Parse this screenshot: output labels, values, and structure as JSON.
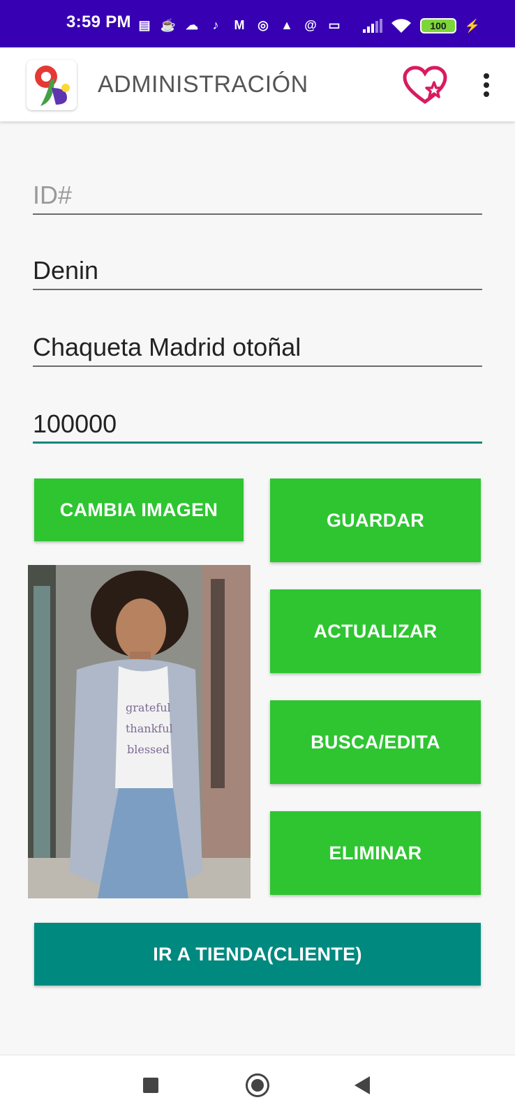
{
  "status_bar": {
    "time": "3:59 PM",
    "battery": "100",
    "notification_icons": [
      "message-icon",
      "java-icon",
      "cloud-icon",
      "tiktok-icon",
      "gmail-icon",
      "headset-icon",
      "adobe-icon",
      "at-icon",
      "laptop-icon"
    ]
  },
  "app_bar": {
    "title": "ADMINISTRACIÓN",
    "accent_color": "#d81b60"
  },
  "form": {
    "id_placeholder": "ID#",
    "category_value": "Denin",
    "name_value": "Chaqueta Madrid otoñal",
    "price_value": "100000"
  },
  "buttons": {
    "change_image": "CAMBIA IMAGEN",
    "save": "GUARDAR",
    "update": "ACTUALIZAR",
    "search_edit": "BUSCA/EDITA",
    "delete": "ELIMINAR",
    "go_to_store": "IR A TIENDA(CLIENTE)"
  },
  "colors": {
    "status_bar": "#3700b3",
    "button_green": "#2ec531",
    "button_teal": "#00897f",
    "active_underline": "#00897b"
  }
}
